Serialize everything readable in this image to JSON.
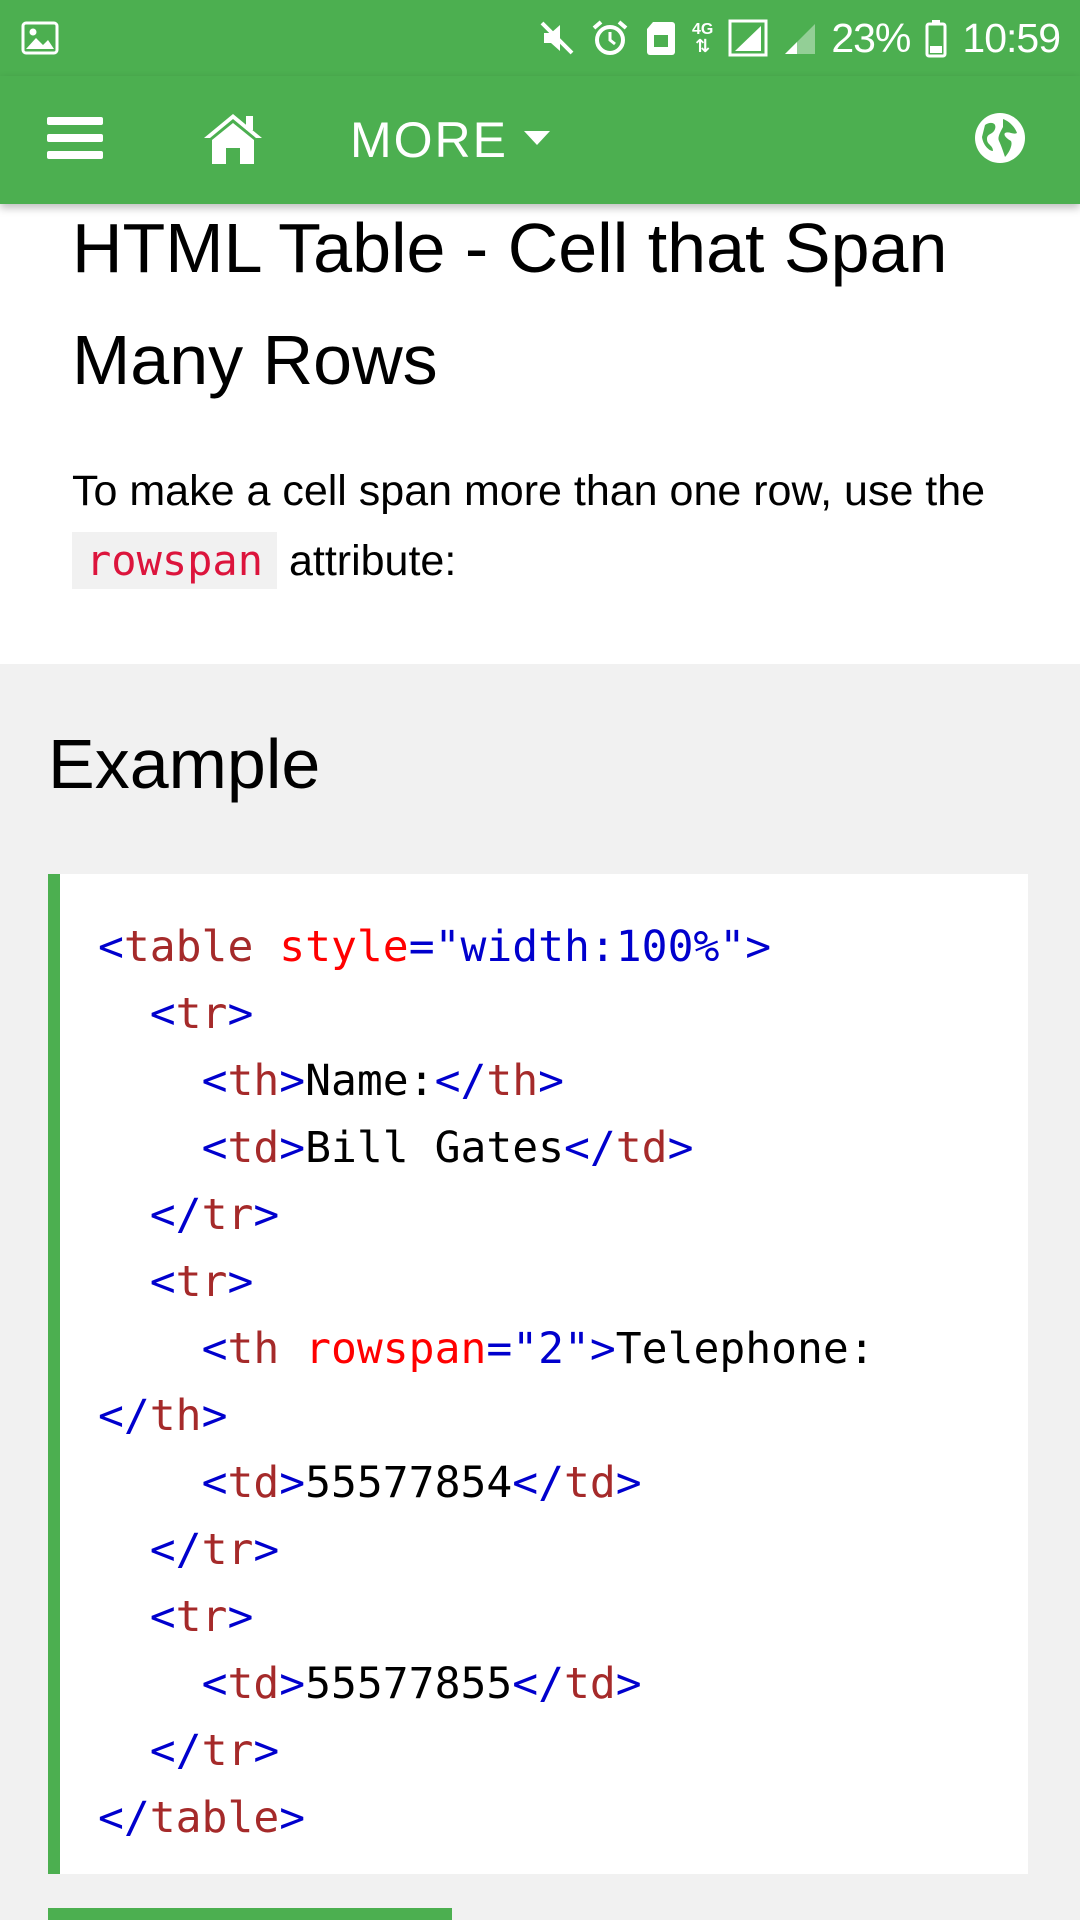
{
  "status_bar": {
    "icons": [
      "image-icon",
      "mute-icon",
      "alarm-icon",
      "sd-card-icon",
      "4g-icon",
      "signal-icon",
      "signal-weak-icon",
      "battery-icon"
    ],
    "network": "4G",
    "battery": "23%",
    "time": "10:59"
  },
  "toolbar": {
    "menu_icon": "hamburger-menu-icon",
    "home_icon": "home-icon",
    "more_label": "MORE",
    "globe_icon": "globe-icon"
  },
  "page": {
    "title": "HTML Table - Cell that Span Many Rows",
    "intro_before": "To make a cell span more than one row, use the ",
    "intro_code": "rowspan",
    "intro_after": " attribute:"
  },
  "example": {
    "heading": "Example",
    "code": {
      "l1_tag": "table",
      "l1_attr": "style",
      "l1_val": "\"width:100%\"",
      "l2_tag": "tr",
      "l3_tag": "th",
      "l3_text": "Name:",
      "l4_tag": "td",
      "l4_text": "Bill Gates",
      "l5_tag": "tr",
      "l6_tag": "tr",
      "l7_tag": "th",
      "l7_attr": "rowspan",
      "l7_val": "\"2\"",
      "l7_text": "Telephone:",
      "l8_tag": "th",
      "l9_tag": "td",
      "l9_text": "55577854",
      "l10_tag": "tr",
      "l11_tag": "tr",
      "l12_tag": "td",
      "l12_text": "55577855",
      "l13_tag": "tr",
      "l14_tag": "table"
    }
  },
  "colors": {
    "accent": "#4caf50",
    "code_tag": "#a52a2a",
    "code_bracket": "#0000cd",
    "code_attr": "#ff0000",
    "inline_code": "#dc143c",
    "example_bg": "#f1f1f1"
  }
}
